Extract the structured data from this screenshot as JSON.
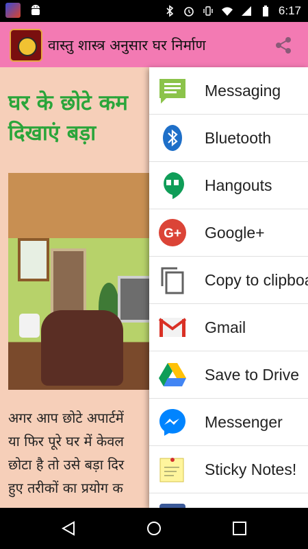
{
  "status_bar": {
    "time": "6:17",
    "icons": [
      "app-icon",
      "android-icon",
      "bluetooth-icon",
      "alarm-icon",
      "vibrate-icon",
      "wifi-icon",
      "signal-icon",
      "battery-icon"
    ]
  },
  "app_bar": {
    "title": "वास्तु शास्त्र अनुसार घर निर्माण",
    "accent_color": "#f37ab3"
  },
  "article": {
    "headline_line1": "घर के छोटे कम",
    "headline_line2": "दिखाएं बड़ा",
    "body_lines": [
      "अगर आप छोटे अपार्टमें",
      "या फिर पूरे घर में केवल",
      "छोटा है तो उसे बड़ा दिर",
      "हुए तरीकों का प्रयोग क"
    ]
  },
  "share_sheet": {
    "items": [
      {
        "label": "Messaging",
        "icon": "messaging-icon"
      },
      {
        "label": "Bluetooth",
        "icon": "bluetooth-icon"
      },
      {
        "label": "Hangouts",
        "icon": "hangouts-icon"
      },
      {
        "label": "Google+",
        "icon": "google-plus-icon"
      },
      {
        "label": "Copy to clipboa",
        "icon": "copy-icon"
      },
      {
        "label": "Gmail",
        "icon": "gmail-icon"
      },
      {
        "label": "Save to Drive",
        "icon": "drive-icon"
      },
      {
        "label": "Messenger",
        "icon": "messenger-icon"
      },
      {
        "label": "Sticky Notes!",
        "icon": "sticky-notes-icon"
      }
    ]
  },
  "nav_bar": {
    "buttons": [
      "back-icon",
      "home-icon",
      "recents-icon"
    ]
  }
}
